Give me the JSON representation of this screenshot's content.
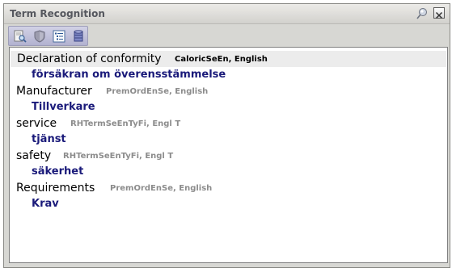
{
  "window": {
    "title": "Term Recognition"
  },
  "toolbar": {
    "buttons": [
      {
        "icon": "magnifier-document-icon"
      },
      {
        "icon": "shield-icon"
      },
      {
        "icon": "list-tree-icon"
      },
      {
        "icon": "database-icon"
      }
    ]
  },
  "terms": [
    {
      "term": "Declaration of conformity",
      "source": "CaloricSeEn, English",
      "translation": "försäkran om överensstämmelse"
    },
    {
      "term": "Manufacturer",
      "source": "PremOrdEnSe, English",
      "translation": "Tillverkare"
    },
    {
      "term": "service",
      "source": "RHTermSeEnTyFi, Engl T",
      "translation": "tjänst"
    },
    {
      "term": "safety",
      "source": "RHTermSeEnTyFi, Engl T",
      "translation": "säkerhet"
    },
    {
      "term": "Requirements",
      "source": "PremOrdEnSe, English",
      "translation": "Krav"
    }
  ],
  "colors": {
    "translation": "#1a1a7a",
    "source": "#8c8c8c",
    "highlight": "#ececec"
  }
}
